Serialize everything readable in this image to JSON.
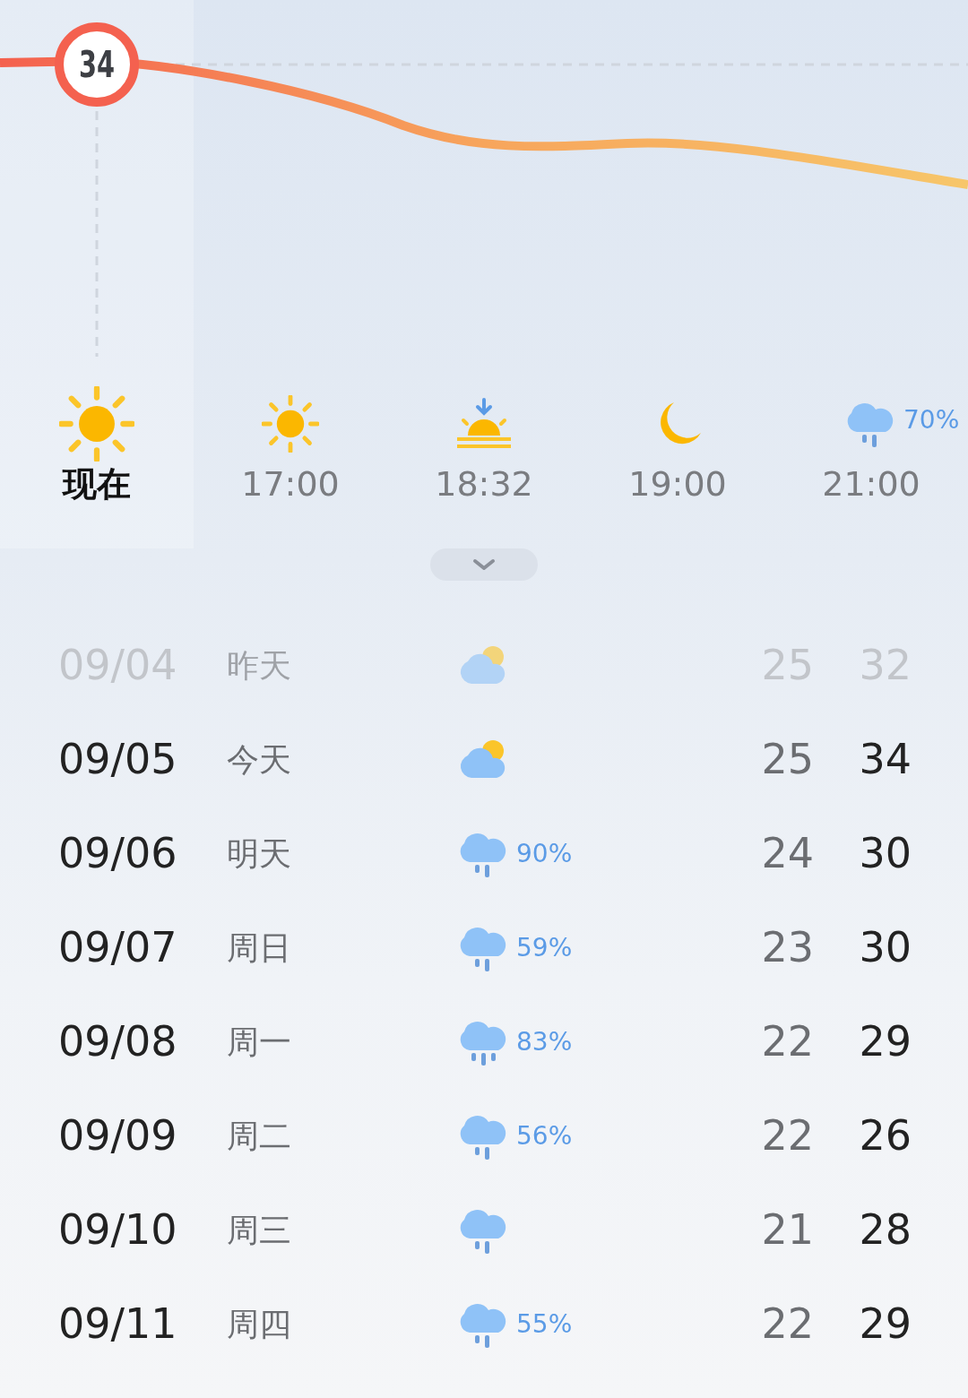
{
  "temperature_chart": {
    "current_label": "34"
  },
  "hourly": [
    {
      "time": "现在",
      "kind": "sun",
      "selected": true
    },
    {
      "time": "17:00",
      "kind": "sun",
      "selected": false
    },
    {
      "time": "18:32",
      "kind": "sunset",
      "selected": false
    },
    {
      "time": "19:00",
      "kind": "moon",
      "selected": false
    },
    {
      "time": "21:00",
      "kind": "rain",
      "precip": "70%",
      "selected": false
    }
  ],
  "daily": [
    {
      "date": "09/04",
      "day": "昨天",
      "kind": "partly_cloudy",
      "low": "25",
      "high": "32",
      "past": true
    },
    {
      "date": "09/05",
      "day": "今天",
      "kind": "partly_cloudy",
      "low": "25",
      "high": "34",
      "past": false
    },
    {
      "date": "09/06",
      "day": "明天",
      "kind": "rain",
      "precip": "90%",
      "low": "24",
      "high": "30",
      "past": false
    },
    {
      "date": "09/07",
      "day": "周日",
      "kind": "rain",
      "precip": "59%",
      "low": "23",
      "high": "30",
      "past": false
    },
    {
      "date": "09/08",
      "day": "周一",
      "kind": "showers",
      "precip": "83%",
      "low": "22",
      "high": "29",
      "past": false
    },
    {
      "date": "09/09",
      "day": "周二",
      "kind": "rain",
      "precip": "56%",
      "low": "22",
      "high": "26",
      "past": false
    },
    {
      "date": "09/10",
      "day": "周三",
      "kind": "rain",
      "low": "21",
      "high": "28",
      "past": false
    },
    {
      "date": "09/11",
      "day": "周四",
      "kind": "rain",
      "precip": "55%",
      "low": "22",
      "high": "29",
      "past": false
    }
  ]
}
